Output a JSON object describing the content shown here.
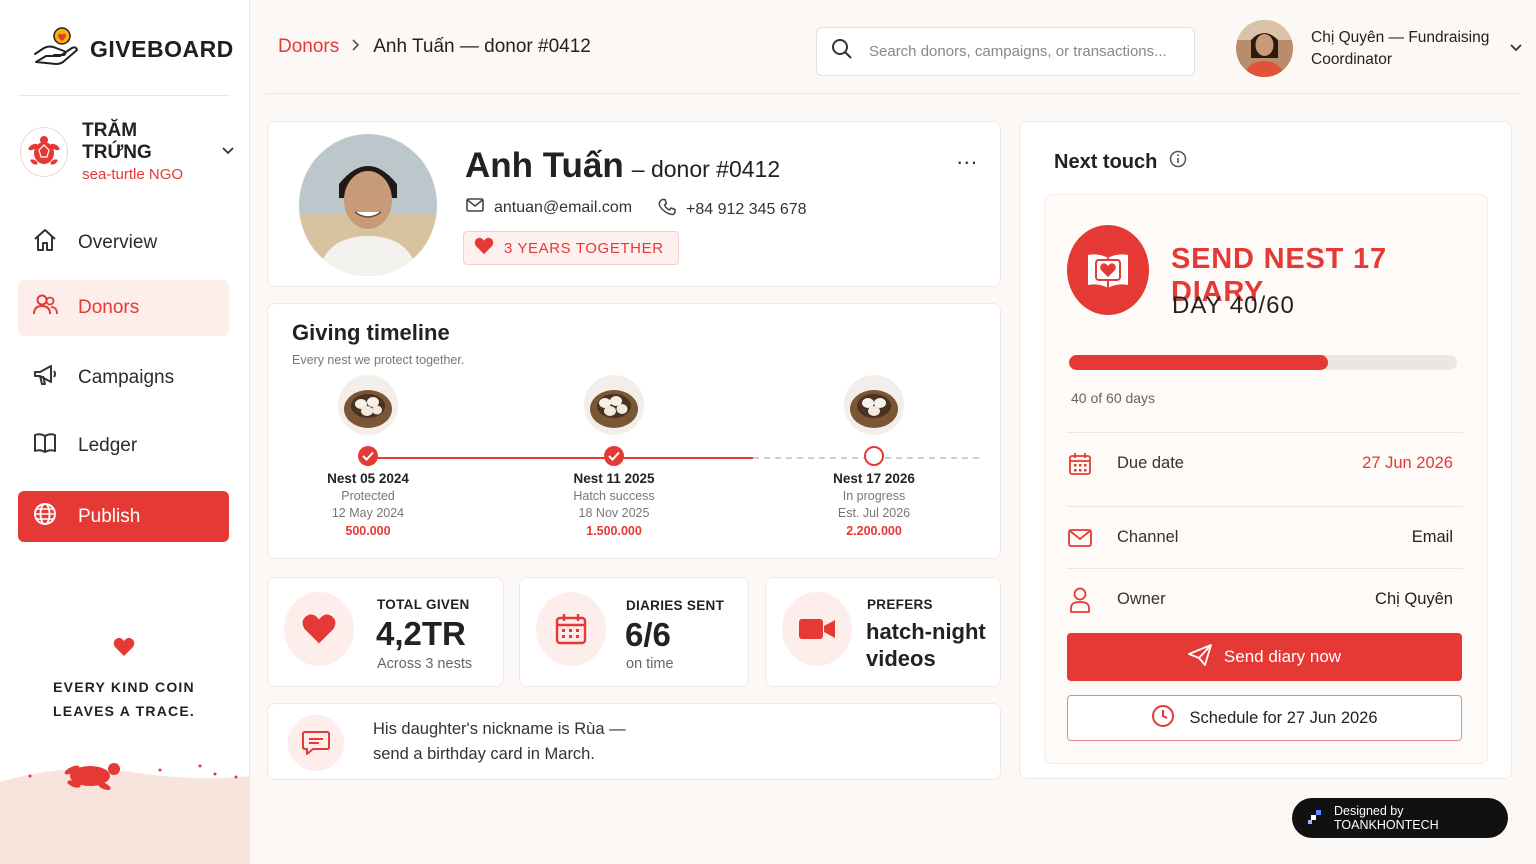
{
  "brand": {
    "name": "GIVEBOARD",
    "accent": "#e53935"
  },
  "org": {
    "name": "TRĂM TRỨNG",
    "subtitle": "sea-turtle NGO"
  },
  "nav": [
    {
      "label": "Overview",
      "icon": "home-icon"
    },
    {
      "label": "Donors",
      "icon": "users-icon",
      "active": true
    },
    {
      "label": "Campaigns",
      "icon": "megaphone-icon"
    },
    {
      "label": "Ledger",
      "icon": "book-icon"
    },
    {
      "label": "Publish",
      "icon": "globe-icon"
    }
  ],
  "sidebar_tagline": {
    "line1": "EVERY KIND COIN",
    "line2": "LEAVES A TRACE."
  },
  "breadcrumb": {
    "parent": "Donors",
    "separator": ">",
    "current": "Anh Tuấn — donor #0412"
  },
  "search": {
    "placeholder": "Search donors, campaigns, or transactions..."
  },
  "user": {
    "line1": "Chị Quyên — Fundraising",
    "line2": "Coordinator"
  },
  "profile": {
    "name": "Anh Tuấn",
    "donor_id": "– donor #0412",
    "email": "antuan@email.com",
    "phone": "+84 912 345 678",
    "badge": "3 YEARS TOGETHER",
    "more": "..."
  },
  "timeline": {
    "title": "Giving timeline",
    "subtitle": "Every nest we protect together.",
    "nests": [
      {
        "title": "Nest 05 2024",
        "status": "Protected",
        "date": "12 May 2024",
        "amount": "500.000",
        "state": "done"
      },
      {
        "title": "Nest 11 2025",
        "status": "Hatch success",
        "date": "18 Nov 2025",
        "amount": "1.500.000",
        "state": "done"
      },
      {
        "title": "Nest 17 2026",
        "status": "In progress",
        "date": "Est. Jul 2026",
        "amount": "2.200.000",
        "state": "open"
      }
    ]
  },
  "stats": {
    "total": {
      "label": "TOTAL GIVEN",
      "value": "4,2TR",
      "sub": "Across 3 nests"
    },
    "diaries": {
      "label": "DIARIES SENT",
      "value": "6/6",
      "sub": "on time"
    },
    "prefers": {
      "label": "PREFERS",
      "value": "hatch-night videos"
    }
  },
  "note": {
    "line1": "His daughter's nickname is Rùa —",
    "line2": "send a birthday card in March."
  },
  "next_touch": {
    "title": "Next touch",
    "task": "SEND NEST 17 DIARY",
    "day": "DAY 40/60",
    "progress_fraction": 0.6667,
    "progress_text": "40 of 60 days",
    "rows": [
      {
        "label": "Due date",
        "value": "27 Jun 2026",
        "icon": "calendar-icon"
      },
      {
        "label": "Channel",
        "value": "Email",
        "icon": "mail-icon"
      },
      {
        "label": "Owner",
        "value": "Chị Quyên",
        "icon": "user-icon"
      }
    ],
    "send_label": "Send diary now",
    "schedule_label": "Schedule for 27 Jun 2026"
  },
  "footer_badge": "Designed by TOANKHONTECH"
}
